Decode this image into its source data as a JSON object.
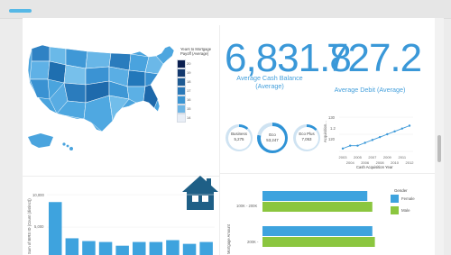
{
  "colors": {
    "accent": "#3a98d8",
    "ring_blue": "#2f93d6",
    "ring_track": "#cfe3f2",
    "bar_blue": "#3ea3de",
    "bar_green": "#8bc63f",
    "house": "#1e5f86",
    "map_fill_range": [
      "#9fd1ee",
      "#1c6aa8"
    ]
  },
  "map_legend": {
    "title": "Years to Mortgage Payoff (Average)",
    "items": [
      {
        "label": "20",
        "color": "#0b1f4f"
      },
      {
        "label": "19",
        "color": "#14396e"
      },
      {
        "label": "18",
        "color": "#1f5b93"
      },
      {
        "label": "17",
        "color": "#2b79b8"
      },
      {
        "label": "16",
        "color": "#3c95d2"
      },
      {
        "label": "15",
        "color": "#6fb6e5"
      },
      {
        "label": "14",
        "color": "#e9eef6"
      }
    ]
  },
  "kpis": [
    {
      "value": "6,831.8",
      "label": "Average Cash Balance (Average)"
    },
    {
      "value": "727.2",
      "label": "Average Debit (Average)"
    }
  ],
  "rings": [
    {
      "name": "Business",
      "value": "5,275"
    },
    {
      "name": "Eco",
      "value": "53,247"
    },
    {
      "name": "Eco Plus",
      "value": "7,053"
    }
  ],
  "cash_chart": {
    "title": "Cash Acquisition Year",
    "ylabel": "Acquisition...",
    "y_ticks": [
      "130",
      "1.2",
      "120"
    ]
  },
  "bottom_left": {
    "ylabel": "Sum of BIRS ID (Count (distinct))",
    "y_ticks": [
      "10,000",
      "5,000"
    ]
  },
  "bottom_right": {
    "ylabel": "Mortgage Amount",
    "bands": [
      "100K - 200K",
      "200K - "
    ]
  },
  "gender_legend": {
    "title": "Gender",
    "items": [
      {
        "label": "Female",
        "color": "#3ea3de"
      },
      {
        "label": "Male",
        "color": "#8bc63f"
      }
    ]
  },
  "chart_data": [
    {
      "type": "line",
      "title": "Cash Acquisition Year",
      "xlabel": "",
      "ylabel": "Acquisition...",
      "x": [
        "2003",
        "2004",
        "2005",
        "2006",
        "2007",
        "2008",
        "2009",
        "2010",
        "2011",
        "2012"
      ],
      "y": [
        120,
        121,
        121,
        122,
        123,
        124,
        125,
        126,
        127,
        128
      ],
      "ylim": [
        119,
        131
      ],
      "x_tick_labels_row1": [
        "2003",
        "2005",
        "2007",
        "2009",
        "2011"
      ],
      "x_tick_labels_row2": [
        "2004",
        "2006",
        "2008",
        "2010",
        "2012"
      ]
    },
    {
      "type": "bar",
      "title": "",
      "ylabel": "Sum of BIRS ID (Count (distinct))",
      "categories": [
        "",
        "",
        "",
        "",
        "",
        "",
        "",
        "",
        "",
        ""
      ],
      "values": [
        9200,
        5300,
        5000,
        4900,
        4500,
        4900,
        4900,
        5100,
        4700,
        4900
      ],
      "ylim": [
        3500,
        10000
      ]
    },
    {
      "type": "bar",
      "orientation": "horizontal",
      "title": "",
      "ylabel": "Mortgage Amount",
      "categories": [
        "100K - 200K",
        "200K - "
      ],
      "series": [
        {
          "name": "Female",
          "values": [
            0.83,
            0.87
          ]
        },
        {
          "name": "Male",
          "values": [
            0.87,
            0.89
          ]
        }
      ]
    }
  ]
}
